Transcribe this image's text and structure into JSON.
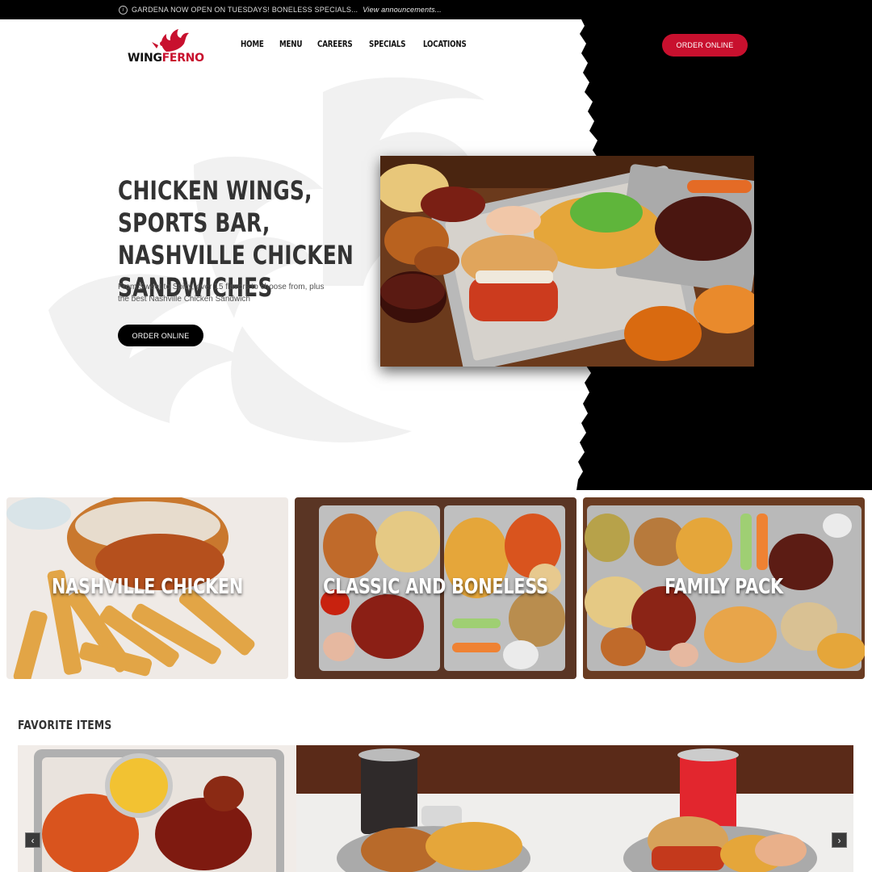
{
  "announcement": {
    "text": "GARDENA NOW OPEN ON TUESDAYS! BONELESS SPECIALS...",
    "link": "View announcements..."
  },
  "brand": {
    "name_part1": "WING",
    "name_part2": "FERNO"
  },
  "nav": [
    "HOME",
    "MENU",
    "CAREERS",
    "SPECIALS",
    "LOCATIONS"
  ],
  "header": {
    "order_button": "ORDER ONLINE"
  },
  "hero": {
    "title": "CHICKEN WINGS, SPORTS BAR, NASHVILLE CHICKEN SANDWICHES",
    "subtitle": "From Sweet to Spicy, over 15 flavors to choose from, plus the best Nashville Chicken Sandwich",
    "cta": "ORDER ONLINE"
  },
  "categories": [
    "NASHVILLE CHICKEN",
    "CLASSIC AND BONELESS",
    "FAMILY PACK"
  ],
  "favorites": {
    "title": "FAVORITE ITEMS",
    "prev_icon": "chevron-left-icon",
    "next_icon": "chevron-right-icon"
  },
  "colors": {
    "brand_red": "#c8102e",
    "black": "#000000"
  }
}
